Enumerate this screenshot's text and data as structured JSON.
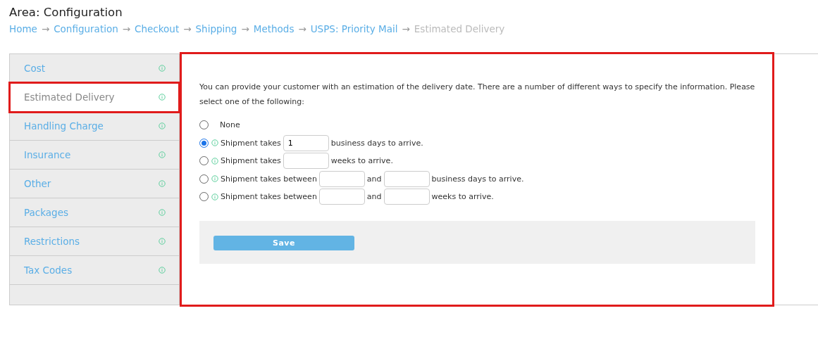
{
  "header": {
    "title": "Area: Configuration"
  },
  "breadcrumb": [
    {
      "label": "Home",
      "current": false
    },
    {
      "label": "Configuration",
      "current": false
    },
    {
      "label": "Checkout",
      "current": false
    },
    {
      "label": "Shipping",
      "current": false
    },
    {
      "label": "Methods",
      "current": false
    },
    {
      "label": "USPS: Priority Mail",
      "current": false
    },
    {
      "label": "Estimated Delivery",
      "current": true
    }
  ],
  "breadcrumb_separator": "→",
  "sidebar": {
    "items": [
      {
        "label": "Cost",
        "selected": false,
        "highlighted": false
      },
      {
        "label": "Estimated Delivery",
        "selected": true,
        "highlighted": true
      },
      {
        "label": "Handling Charge",
        "selected": false,
        "highlighted": false
      },
      {
        "label": "Insurance",
        "selected": false,
        "highlighted": false
      },
      {
        "label": "Other",
        "selected": false,
        "highlighted": false
      },
      {
        "label": "Packages",
        "selected": false,
        "highlighted": false
      },
      {
        "label": "Restrictions",
        "selected": false,
        "highlighted": false
      },
      {
        "label": "Tax Codes",
        "selected": false,
        "highlighted": false
      }
    ]
  },
  "content": {
    "highlighted": true,
    "intro": "You can provide your customer with an estimation of the delivery date. There are a number of different ways to specify the information. Please select one of the following:",
    "options": [
      {
        "selected": false,
        "info": false,
        "parts": [
          {
            "kind": "text",
            "text": "None"
          }
        ]
      },
      {
        "selected": true,
        "info": true,
        "parts": [
          {
            "kind": "text",
            "text": "Shipment takes"
          },
          {
            "kind": "field",
            "value": "1"
          },
          {
            "kind": "text",
            "text": "business days to arrive."
          }
        ]
      },
      {
        "selected": false,
        "info": true,
        "parts": [
          {
            "kind": "text",
            "text": "Shipment takes"
          },
          {
            "kind": "field"
          },
          {
            "kind": "text",
            "text": "weeks to arrive."
          }
        ]
      },
      {
        "selected": false,
        "info": true,
        "parts": [
          {
            "kind": "text",
            "text": "Shipment takes between"
          },
          {
            "kind": "field"
          },
          {
            "kind": "text",
            "text": "and"
          },
          {
            "kind": "field"
          },
          {
            "kind": "text",
            "text": "business days to arrive."
          }
        ]
      },
      {
        "selected": false,
        "info": true,
        "parts": [
          {
            "kind": "text",
            "text": "Shipment takes between"
          },
          {
            "kind": "field"
          },
          {
            "kind": "text",
            "text": "and"
          },
          {
            "kind": "field"
          },
          {
            "kind": "text",
            "text": "weeks to arrive."
          }
        ]
      }
    ],
    "save_button": "Save"
  }
}
